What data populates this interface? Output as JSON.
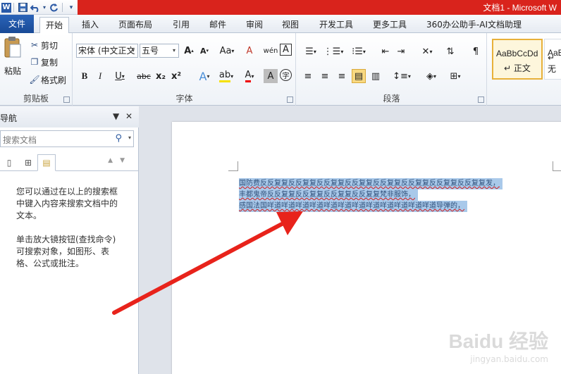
{
  "window": {
    "title": "文档1 - Microsoft W",
    "qat": {
      "word_icon": "W",
      "save_icon": "save-icon",
      "undo_icon": "undo-icon",
      "redo_icon": "redo-icon",
      "customize_icon": "customize-qat-icon"
    }
  },
  "tabs": [
    {
      "label": "文件"
    },
    {
      "label": "开始"
    },
    {
      "label": "插入"
    },
    {
      "label": "页面布局"
    },
    {
      "label": "引用"
    },
    {
      "label": "邮件"
    },
    {
      "label": "审阅"
    },
    {
      "label": "视图"
    },
    {
      "label": "开发工具"
    },
    {
      "label": "更多工具"
    },
    {
      "label": "360办公助手-AI文档助理"
    }
  ],
  "ribbon": {
    "clipboard": {
      "label": "剪贴板",
      "paste": "粘贴",
      "cut": "剪切",
      "copy": "复制",
      "format_painter": "格式刷"
    },
    "font": {
      "label": "字体",
      "font_name": "宋体 (中文正文",
      "font_size": "五号",
      "grow": "A",
      "shrink": "A",
      "case": "Aa",
      "clear": "A",
      "phonetic": "wén",
      "border": "A",
      "bold": "B",
      "italic": "I",
      "underline": "U",
      "strike": "abc",
      "subscript": "x₂",
      "superscript": "x²",
      "effects": "A",
      "highlight": "ab",
      "color": "A",
      "shading": "A",
      "enclose": "字"
    },
    "paragraph": {
      "label": "段落"
    },
    "styles": {
      "style1_sample": "AaBbCcDd",
      "style1_name": "正文",
      "style2_sample": "AaBb",
      "style2_name": "无"
    }
  },
  "nav": {
    "title": "导航",
    "search_placeholder": "搜索文档",
    "help_text_1": "您可以通过在以上的搜索框中键入内容来搜索文档中的文本。",
    "help_text_2": "单击放大镜按钮(查找命令)可搜索对象，如图形、表格、公式或批注。"
  },
  "document": {
    "lines": [
      "国防费反反复复反反复复反反复复反反复复反反复复反反复复反反复复反反复复发，",
      "丰都鬼帝反反复复反反复复反反复复反反复复梵非服饰，",
      "感国法国咩道咩道咩道咩道咩道咩道咩道咩道咩道咩道咩道咩道导弹的，"
    ]
  },
  "watermark": {
    "line1": "Baidu 经验",
    "line2": "jingyan.baidu.com"
  },
  "colors": {
    "file_tab": "#1f55a8",
    "title_red": "#d9231c",
    "selection": "#a9c9ea",
    "arrow": "#e8231b"
  }
}
